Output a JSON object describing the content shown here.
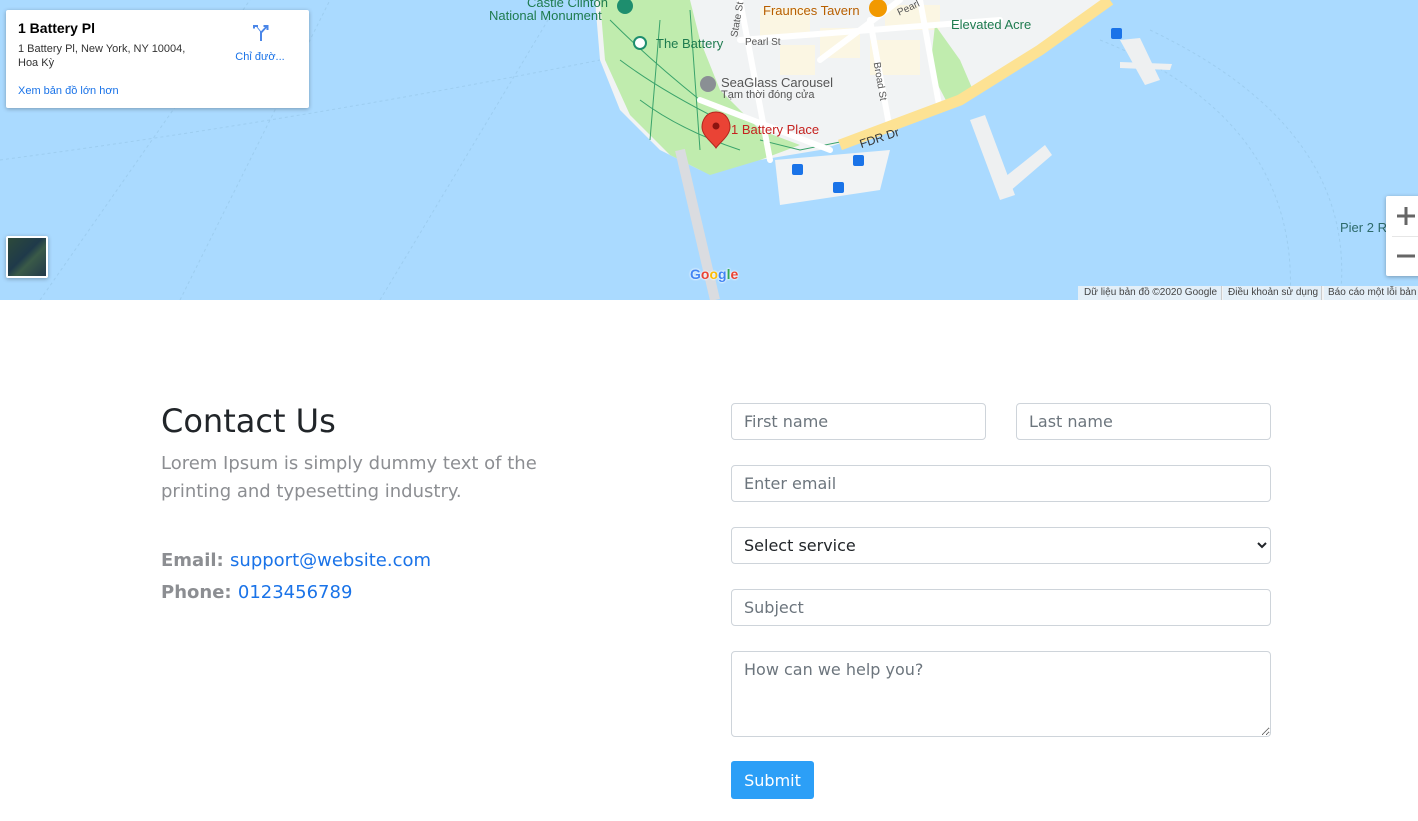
{
  "map": {
    "labels": {
      "castle_clinton": "Castle Clinton",
      "national_monument": "National Monument",
      "fraunces_tavern": "Fraunces Tavern",
      "elevated_acre": "Elevated Acre",
      "the_battery": "The Battery",
      "pearl_st": "Pearl St",
      "pearl_st_2": "Pearl",
      "state_st": "State St",
      "broad_st": "Broad St",
      "seaglass": "SeaGlass Carousel",
      "seaglass_status": "Tạm thời đóng cửa",
      "battery_place": "1 Battery Place",
      "fdr_dr": "FDR Dr",
      "pier2": "Pier 2 R"
    },
    "info_card": {
      "place_name": "1 Battery Pl",
      "address": "1 Battery Pl, New York, NY 10004, Hoa Kỳ",
      "directions_label": "Chỉ đườ...",
      "bigger_map_link": "Xem bản đồ lớn hơn"
    },
    "google_logo": [
      "G",
      "o",
      "o",
      "g",
      "l",
      "e"
    ],
    "attribution": {
      "data": "Dữ liệu bản đồ ©2020 Google",
      "terms": "Điều khoản sử dụng",
      "report": "Báo cáo một lỗi bản"
    },
    "colors": {
      "water": "#aadaff",
      "park": "#c0ecae",
      "land": "#f1f3f4",
      "highway": "#fde293",
      "pin": "#ea4335",
      "transit": "#1a73e8"
    }
  },
  "contact": {
    "title": "Contact Us",
    "description": "Lorem Ipsum is simply dummy text of the printing and typesetting industry.",
    "email_label": "Email:",
    "email_value": "support@website.com",
    "phone_label": "Phone:",
    "phone_value": "0123456789"
  },
  "form": {
    "first_name_placeholder": "First name",
    "last_name_placeholder": "Last name",
    "email_placeholder": "Enter email",
    "service_selected": "Select service",
    "subject_placeholder": "Subject",
    "message_placeholder": "How can we help you?",
    "submit_label": "Submit",
    "accent_color": "#2c9ff7"
  }
}
